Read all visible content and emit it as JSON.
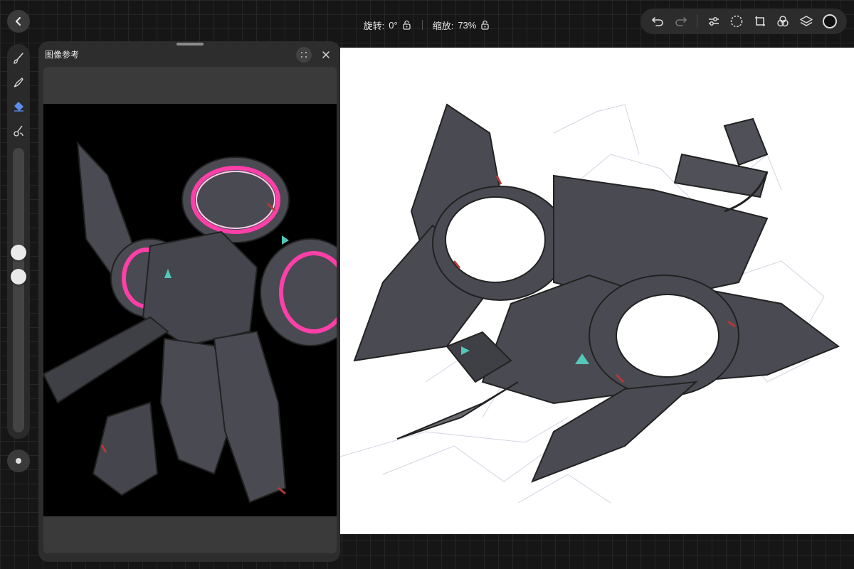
{
  "top_info": {
    "rotation_label": "旋转:",
    "rotation_value": "0°",
    "zoom_label": "缩放:",
    "zoom_value": "73%"
  },
  "toolbar": {
    "icons": [
      "undo-icon",
      "redo-icon",
      "adjustments-icon",
      "selection-icon",
      "transform-icon",
      "symmetry-icon",
      "layers-icon",
      "color-icon"
    ]
  },
  "left_tools": {
    "icons": [
      "brush-icon",
      "smudge-icon",
      "eraser-icon",
      "blend-icon"
    ],
    "brush_size_level": 0.64,
    "opacity_level": 0.55
  },
  "reference_panel": {
    "title": "图像参考"
  },
  "colors": {
    "accent_blue": "#5b8def",
    "panel_bg": "#2d2d2d",
    "canvas_bg": "#ffffff",
    "mecha_body": "#4a4a52",
    "ring_glow": "#ff3fa8"
  }
}
